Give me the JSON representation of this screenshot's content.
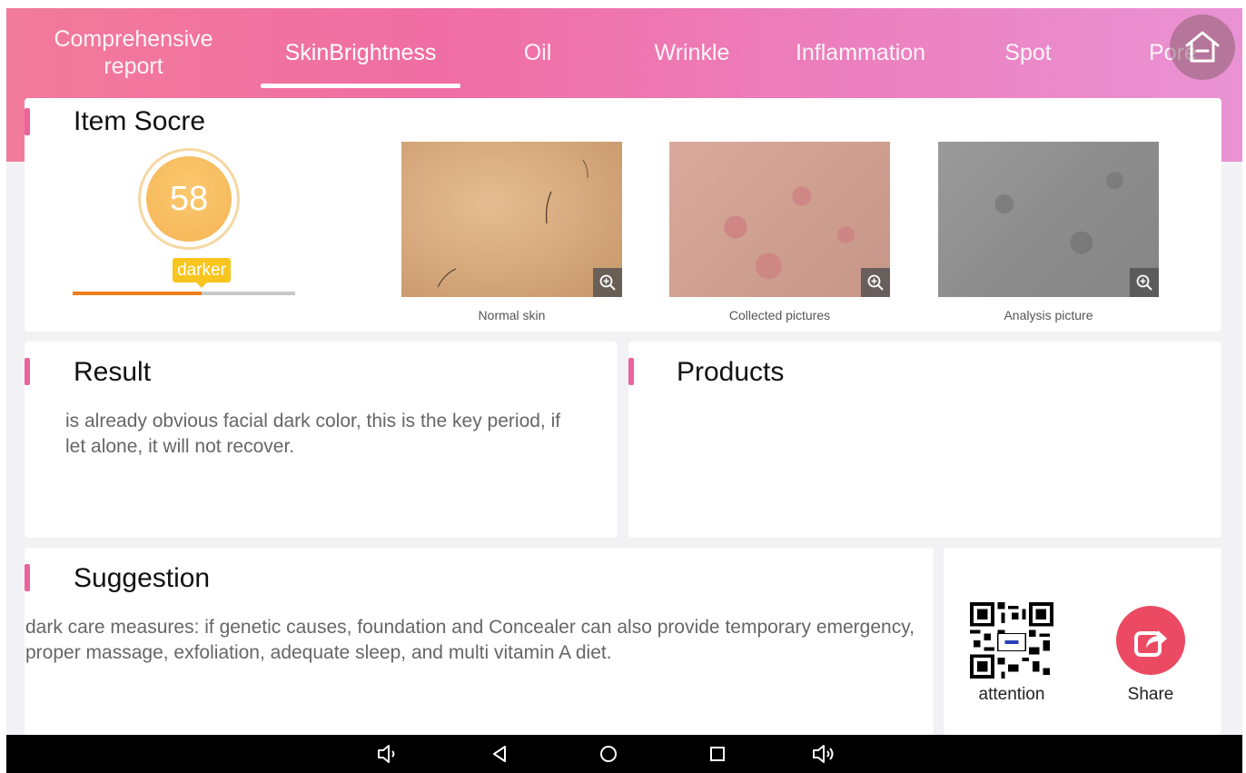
{
  "tabs": [
    {
      "label": "Comprehensive\nreport"
    },
    {
      "label": "SkinBrightness"
    },
    {
      "label": "Oil"
    },
    {
      "label": "Wrinkle"
    },
    {
      "label": "Inflammation"
    },
    {
      "label": "Spot"
    },
    {
      "label": "Pore"
    }
  ],
  "active_tab": "SkinBrightness",
  "score_card": {
    "title": "Item Socre",
    "score": "58",
    "level_label": "darker",
    "level_fraction": 0.58
  },
  "photos": [
    {
      "caption": "Normal skin"
    },
    {
      "caption": "Collected pictures"
    },
    {
      "caption": "Analysis picture"
    }
  ],
  "result": {
    "title": "Result",
    "text": "is already obvious facial dark color, this is the key period, if let alone, it will not recover."
  },
  "products": {
    "title": "Products"
  },
  "suggestion": {
    "title": "Suggestion",
    "text": "dark care measures: if genetic causes, foundation and Concealer can also provide temporary emergency, proper massage, exfoliation, adequate sleep, and multi vitamin A diet."
  },
  "actions": {
    "attention_label": "attention",
    "share_label": "Share"
  },
  "colors": {
    "accent_pink": "#e9649b",
    "score_orange": "#f5b556",
    "level_tag": "#f7c51d",
    "share_red": "#ec4a63"
  },
  "icons": [
    "home-icon",
    "zoom-in-icon",
    "share-icon",
    "qr-code",
    "volume-down-icon",
    "back-icon",
    "home-circle-icon",
    "recents-icon",
    "volume-up-icon"
  ]
}
